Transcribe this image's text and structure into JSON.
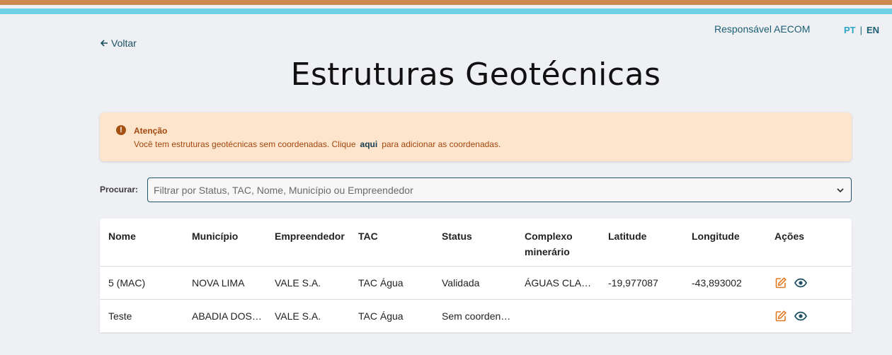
{
  "header": {
    "responsavel": "Responsável AECOM",
    "lang_pt": "PT",
    "lang_sep": "|",
    "lang_en": "EN",
    "back_label": "Voltar"
  },
  "page_title": "Estruturas Geotécnicas",
  "alert": {
    "title": "Atenção",
    "icon_text": "!",
    "msg_before": "Você tem estruturas geotécnicas sem coordenadas. Clique",
    "link": "aqui",
    "msg_after": "para adicionar as coordenadas."
  },
  "search": {
    "label": "Procurar:",
    "placeholder": "Filtrar por Status, TAC, Nome, Município ou Empreendedor"
  },
  "table": {
    "columns": [
      "Nome",
      "Município",
      "Empreendedor",
      "TAC",
      "Status",
      "Complexo minerário",
      "Latitude",
      "Longitude",
      "Ações"
    ],
    "rows": [
      [
        "5 (MAC)",
        "NOVA LIMA",
        "VALE S.A.",
        "TAC Água",
        "Validada",
        "ÁGUAS CLAR…",
        "-19,977087",
        "-43,893002"
      ],
      [
        "Teste",
        "ABADIA DOS …",
        "VALE S.A.",
        "TAC Água",
        "Sem coorden…",
        "",
        "",
        ""
      ]
    ]
  },
  "colors": {
    "accent_orange": "#cc8a4f",
    "accent_blue": "#6fd0e6",
    "action_edit": "#e07b22",
    "action_view": "#1b4f5f"
  },
  "icons": [
    "arrow-left-icon",
    "alert-icon",
    "chevron-down-icon",
    "edit-icon",
    "eye-icon"
  ]
}
